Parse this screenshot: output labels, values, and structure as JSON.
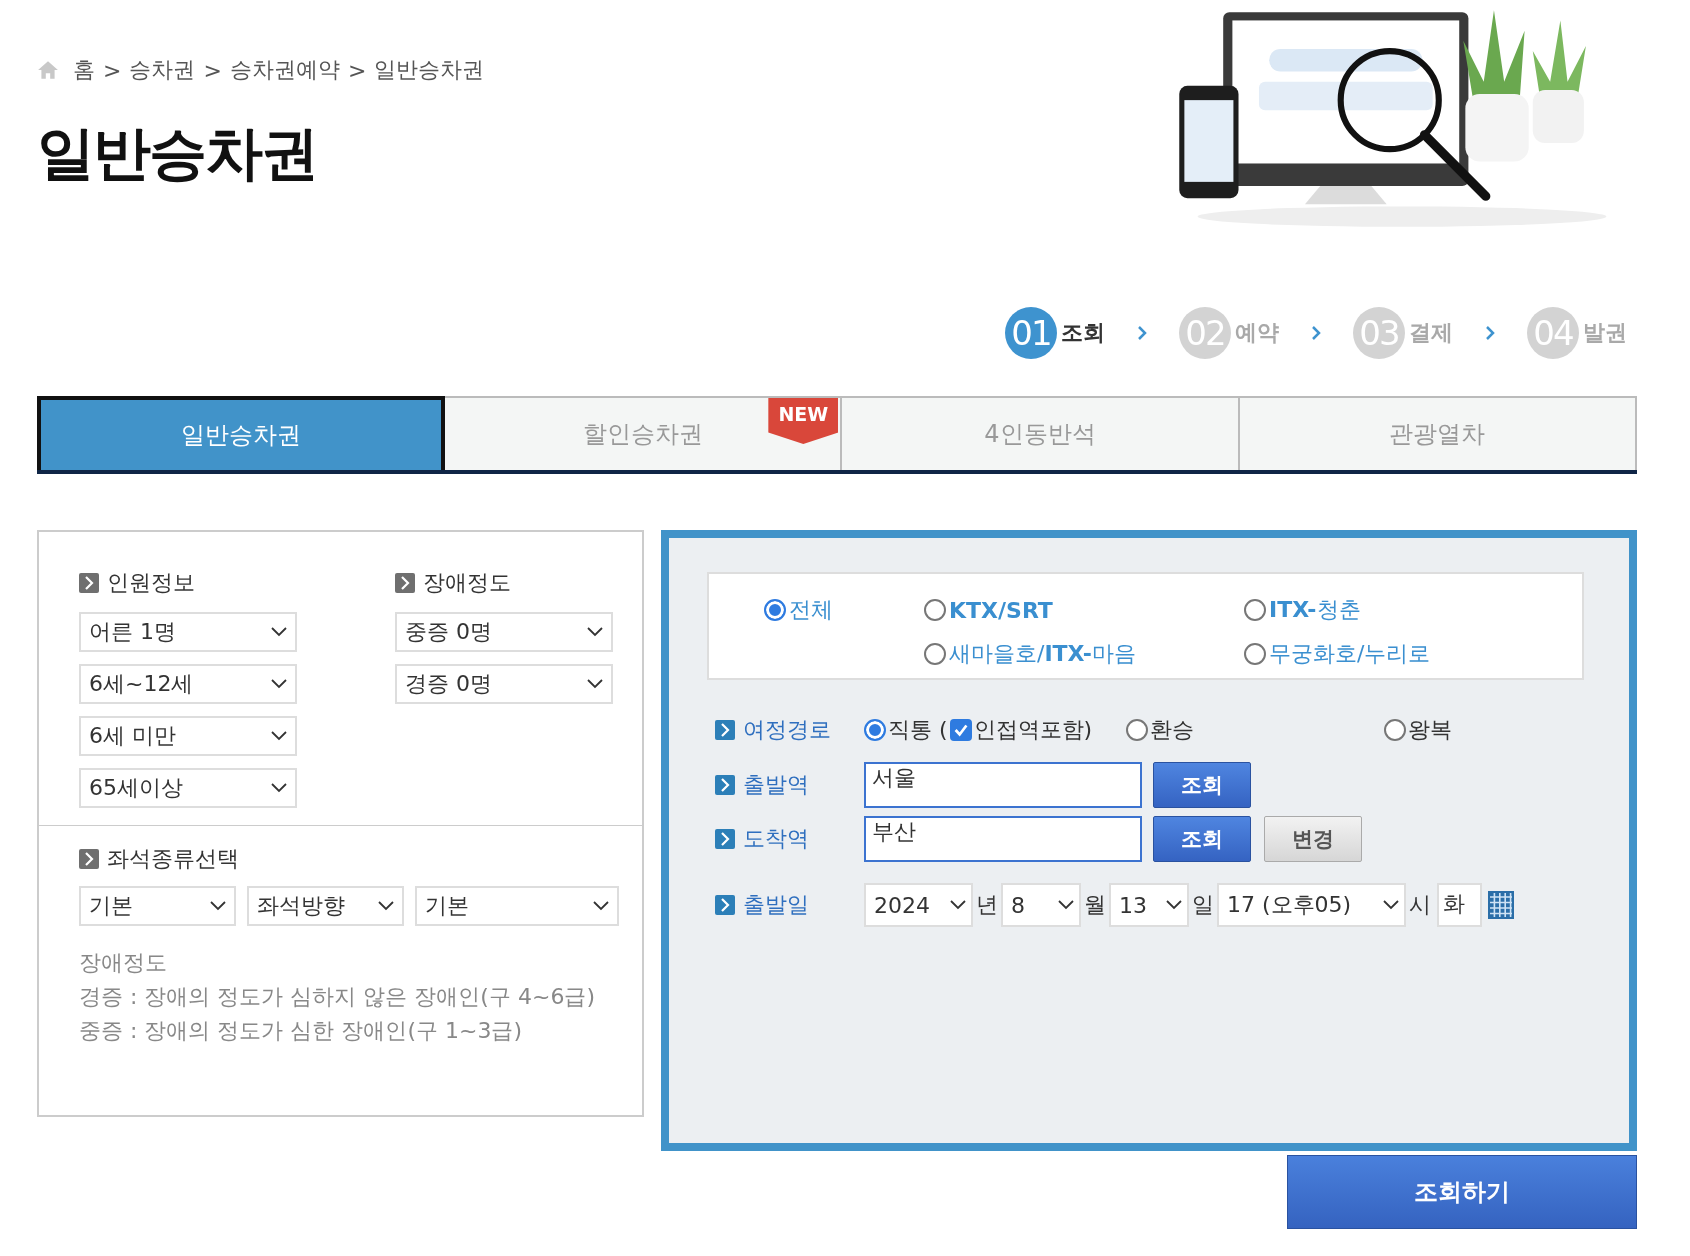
{
  "breadcrumb": {
    "items": [
      "홈",
      "승차권",
      "승차권예약",
      "일반승차권"
    ],
    "separator": ">"
  },
  "title": "일반승차권",
  "steps": [
    {
      "number": "01",
      "label": "조회",
      "selected": true
    },
    {
      "number": "02",
      "label": "예약",
      "selected": false
    },
    {
      "number": "03",
      "label": "결제",
      "selected": false
    },
    {
      "number": "04",
      "label": "발권",
      "selected": false
    }
  ],
  "tabs": [
    {
      "label": "일반승차권",
      "selected": true
    },
    {
      "label": "할인승차권",
      "selected": false,
      "badge": "NEW"
    },
    {
      "label": "4인동반석",
      "selected": false
    },
    {
      "label": "관광열차",
      "selected": false
    }
  ],
  "passengers": {
    "title": "인원정보",
    "selects": [
      "어른 1명",
      "6세~12세",
      "6세 미만",
      "65세이상"
    ]
  },
  "disability": {
    "title": "장애정도",
    "selects": [
      "중증 0명",
      "경증 0명"
    ]
  },
  "seat": {
    "title": "좌석종류선택",
    "selects": [
      "기본",
      "좌석방향",
      "기본"
    ]
  },
  "note": {
    "title": "장애정도",
    "lines": [
      "경증 : 장애의 정도가 심하지 않은 장애인(구 4~6급)",
      "중증 : 장애의 정도가 심한 장애인(구 1~3급)"
    ]
  },
  "train_types": [
    {
      "label": "전체",
      "selected": true,
      "bold": false
    },
    {
      "label": "KTX/SRT",
      "selected": false,
      "bold": true
    },
    {
      "label": "**ITX-**청춘",
      "selected": false,
      "bold": false
    },
    {
      "label": "새마을호/**ITX-**마음",
      "selected": false,
      "bold": false
    },
    {
      "label": "무궁화호/누리로",
      "selected": false,
      "bold": false
    }
  ],
  "route": {
    "label": "여정경로",
    "options": [
      {
        "label": "직통 (",
        "selected": true
      },
      {
        "label": "환승",
        "selected": false
      },
      {
        "label": "왕복",
        "selected": false
      }
    ],
    "adjacent": {
      "label": "인접역포함)",
      "checked": true
    }
  },
  "departure": {
    "label": "출발역",
    "value": "서울",
    "buttons": [
      "조회"
    ]
  },
  "arrival": {
    "label": "도착역",
    "value": "부산",
    "buttons": [
      "조회",
      "변경"
    ]
  },
  "date": {
    "label": "출발일",
    "parts": [
      {
        "value": "2024",
        "unit": "년"
      },
      {
        "value": "8",
        "unit": "월"
      },
      {
        "value": "13",
        "unit": "일"
      },
      {
        "value": "17 (오후05)",
        "unit": "시"
      }
    ],
    "weekday": "화"
  },
  "search_button": "조회하기"
}
